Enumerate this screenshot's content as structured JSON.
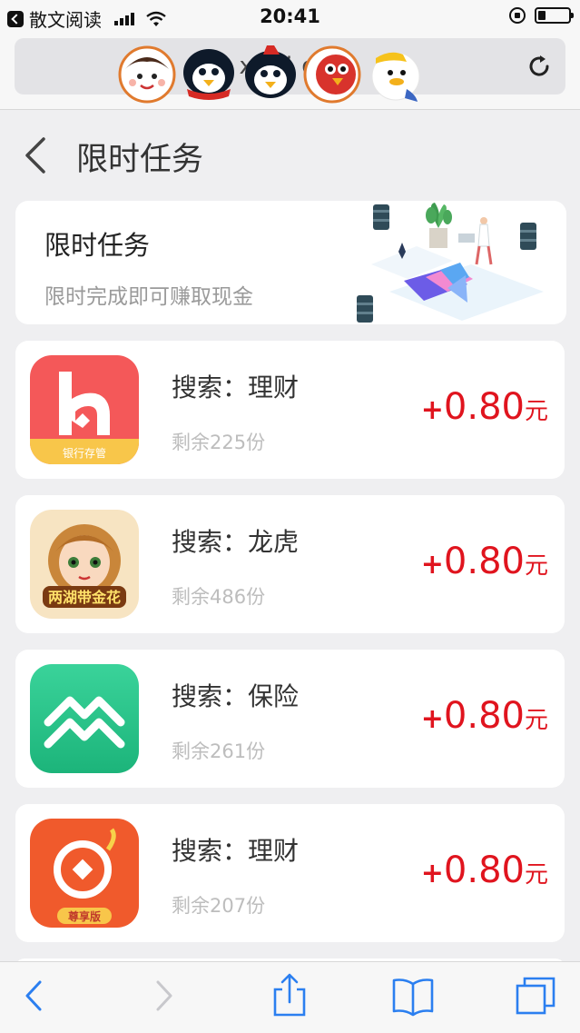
{
  "status": {
    "back_app": "散文阅读",
    "time": "20:41",
    "battery_level": 0.25
  },
  "browser": {
    "url_text": "xi          j       i    om"
  },
  "page": {
    "title": "限时任务"
  },
  "banner": {
    "title": "限时任务",
    "subtitle": "限时完成即可赚取现金"
  },
  "tasks": [
    {
      "name": "搜索：理财",
      "remaining": "剩余225份",
      "plus": "+",
      "amount": "0.80",
      "unit": "元",
      "icon": "h-bank-app-icon",
      "icon_label": "银行存管"
    },
    {
      "name": "搜索：龙虎",
      "remaining": "剩余486份",
      "plus": "+",
      "amount": "0.80",
      "unit": "元",
      "icon": "game-girl-app-icon",
      "icon_label": "两湖带金花"
    },
    {
      "name": "搜索：保险",
      "remaining": "剩余261份",
      "plus": "+",
      "amount": "0.80",
      "unit": "元",
      "icon": "mountain-app-icon"
    },
    {
      "name": "搜索：理财",
      "remaining": "剩余207份",
      "plus": "+",
      "amount": "0.80",
      "unit": "元",
      "icon": "coin-app-icon",
      "icon_label": "尊享版"
    }
  ],
  "colors": {
    "accent_red": "#e0141e",
    "background": "#efeff1"
  }
}
